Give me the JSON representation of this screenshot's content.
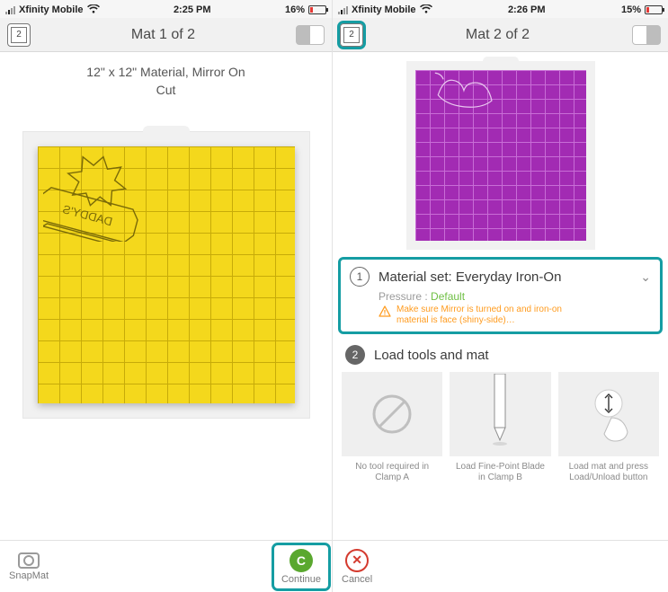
{
  "left": {
    "status": {
      "carrier": "Xfinity Mobile",
      "time": "2:25 PM",
      "battery": "16%"
    },
    "header": {
      "mat_number": "2",
      "title": "Mat 1 of 2"
    },
    "info_line1": "12\" x 12\" Material, Mirror On",
    "info_line2": "Cut",
    "bottom": {
      "snapmat": "SnapMat",
      "continue": "Continue",
      "continue_glyph": "C"
    }
  },
  "right": {
    "status": {
      "carrier": "Xfinity Mobile",
      "time": "2:26 PM",
      "battery": "15%"
    },
    "header": {
      "mat_number": "2",
      "title": "Mat 2 of 2"
    },
    "step1": {
      "num": "1",
      "title": "Material set: Everyday Iron-On",
      "pressure_label": "Pressure :",
      "pressure_value": "Default",
      "warning": "Make sure Mirror is turned on and iron-on material is face (shiny-side)…"
    },
    "step2": {
      "num": "2",
      "title": "Load tools and mat"
    },
    "tools": [
      {
        "caption": "No tool required in Clamp A"
      },
      {
        "caption": "Load Fine-Point Blade in Clamp B"
      },
      {
        "caption": "Load mat and press Load/Unload button"
      }
    ],
    "bottom": {
      "cancel": "Cancel"
    }
  }
}
